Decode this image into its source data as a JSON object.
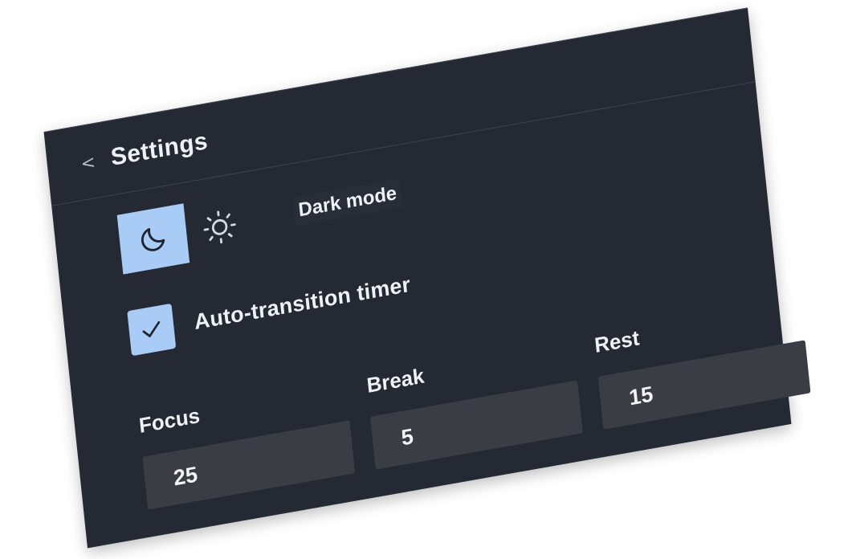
{
  "header": {
    "back_icon": "chevron-left-icon",
    "back_glyph": "<",
    "title": "Settings"
  },
  "theme": {
    "dark_icon": "moon-icon",
    "light_icon": "sun-icon",
    "selected": "dark",
    "label": "Dark mode"
  },
  "auto_transition": {
    "checked": true,
    "label": "Auto-transition timer"
  },
  "timers": {
    "focus": {
      "label": "Focus",
      "value": "25"
    },
    "break": {
      "label": "Break",
      "value": "5"
    },
    "rest": {
      "label": "Rest",
      "value": "15"
    }
  },
  "colors": {
    "panel_bg": "#242933",
    "accent": "#a9ccf7",
    "input_bg": "#3a3d43",
    "text": "#eef1f5"
  }
}
